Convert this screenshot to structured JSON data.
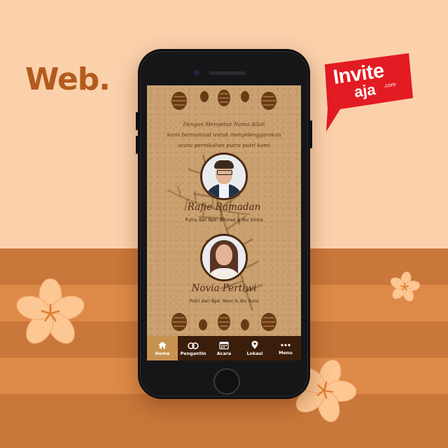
{
  "brand": {
    "heading": "Web.",
    "logo_main": "Invite",
    "logo_sub": "aja",
    "logo_domain": ".com"
  },
  "invitation": {
    "opening_lines": [
      "Dengan Menyebut Nama Allah",
      "kami bermaksud untuk menyelenggarakan",
      "acara pernikahan putra putri kami"
    ],
    "groom": {
      "name": "Rafie Ramadan",
      "parents": "Putra dari Bpk. Ahmad & Ibu Sintia"
    },
    "bride": {
      "name": "Novia Pertiwi",
      "parents": "Putri dari Bpk. Noor & Ibu Yulia"
    }
  },
  "nav": {
    "items": [
      {
        "label": "Home",
        "icon": "home-icon",
        "active": true
      },
      {
        "label": "Pengantin",
        "icon": "rings-icon",
        "active": false
      },
      {
        "label": "Acara",
        "icon": "calendar-icon",
        "active": false
      },
      {
        "label": "Lokasi",
        "icon": "location-pin-icon",
        "active": false
      },
      {
        "label": "Menu",
        "icon": "more-dots-icon",
        "active": false
      }
    ]
  },
  "colors": {
    "background_light": "#fbd1ac",
    "background_dark": "#c9773a",
    "brand_red": "#e31b23",
    "nav_bg": "#3a1d0a",
    "nav_active": "#c7924f",
    "text_brown": "#4b2810"
  }
}
